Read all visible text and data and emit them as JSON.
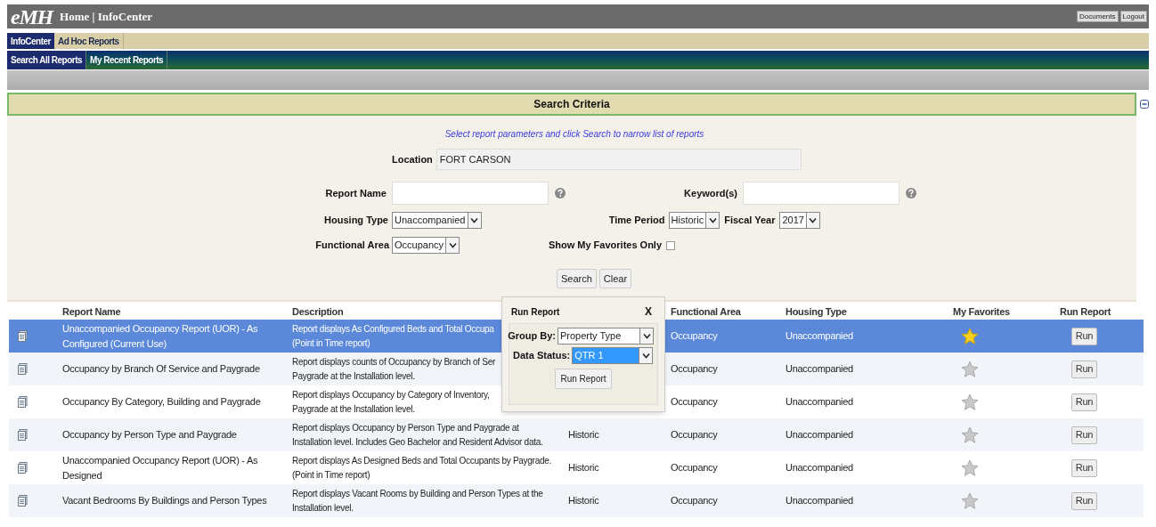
{
  "header": {
    "logo": "eMH",
    "title": "Home | InfoCenter",
    "buttons": [
      "Documents",
      "Logout"
    ]
  },
  "tabs": [
    {
      "label": "InfoCenter",
      "selected": true
    },
    {
      "label": "Ad Hoc Reports",
      "selected": false
    }
  ],
  "subtabs": [
    {
      "label": "Search All Reports",
      "selected": true
    },
    {
      "label": "My Recent Reports",
      "selected": false
    }
  ],
  "search_criteria": {
    "title": "Search Criteria",
    "expanded": true,
    "instructions": "Select report parameters and click Search to narrow list of reports",
    "location": {
      "label": "Location",
      "value": "FORT CARSON"
    },
    "report_name": {
      "label": "Report Name"
    },
    "keywords": {
      "label": "Keyword(s)"
    },
    "housing_type": {
      "label": "Housing Type",
      "value": "Unaccompanied"
    },
    "time_period": {
      "label": "Time Period",
      "value": "Historic"
    },
    "fiscal_year": {
      "label": "Fiscal Year",
      "value": "2017"
    },
    "functional_area": {
      "label": "Functional Area",
      "value": "Occupancy"
    },
    "favorites_only": {
      "label": "Show My Favorites Only",
      "checked": false
    },
    "buttons": [
      "Search",
      "Clear"
    ]
  },
  "table": {
    "columns": {
      "report_name": "Report Name",
      "description": "Description",
      "functional_area": "Functional Area",
      "housing_type": "Housing Type",
      "my_favorites": "My Favorites",
      "run_report": "Run Report"
    },
    "rows": [
      {
        "selected": true,
        "name": "Unaccompanied Occupancy Report (UOR) - As Configured (Current Use)",
        "description_lines": [
          "Report displays As Configured Beds and Total Occupa",
          "(Point in Time report)"
        ],
        "functional_area": "Occupancy",
        "housing_type": "Unaccompanied",
        "favorite": true,
        "run": "Run"
      },
      {
        "selected": false,
        "name": "Occupancy by Branch Of Service and Paygrade",
        "description_lines": [
          "Report displays counts of Occupancy by Branch of Ser",
          "Paygrade at the Installation level."
        ],
        "functional_area": "Occupancy",
        "housing_type": "Unaccompanied",
        "favorite": false,
        "run": "Run"
      },
      {
        "selected": false,
        "name": "Occupancy By Category, Building and Paygrade",
        "description_lines": [
          "Report displays Occupancy by Category of Inventory,",
          "Paygrade at the Installation level."
        ],
        "functional_area": "Occupancy",
        "housing_type": "Unaccompanied",
        "favorite": false,
        "run": "Run"
      },
      {
        "selected": false,
        "name": "Occupancy by Person Type and Paygrade",
        "description_lines": [
          "Report displays Occupancy by Person Type and Paygrade at",
          "Installation level. Includes Geo Bachelor and Resident Advisor data."
        ],
        "column_3": "Historic",
        "functional_area": "Occupancy",
        "housing_type": "Unaccompanied",
        "favorite": false,
        "run": "Run"
      },
      {
        "selected": false,
        "name": "Unaccompanied Occupancy Report (UOR) - As Designed",
        "description_lines": [
          "Report displays As Designed Beds and Total Occupants by Paygrade.",
          "(Point in Time report)"
        ],
        "column_3": "Historic",
        "functional_area": "Occupancy",
        "housing_type": "Unaccompanied",
        "favorite": false,
        "run": "Run"
      },
      {
        "selected": false,
        "name": "Vacant Bedrooms By Buildings and Person Types",
        "description_lines": [
          "Report displays Vacant Rooms by Building and Person Types at the",
          "Installation level."
        ],
        "column_3": "Historic",
        "functional_area": "Occupancy",
        "housing_type": "Unaccompanied",
        "favorite": false,
        "run": "Run"
      }
    ]
  },
  "popup": {
    "title": "Run Report",
    "close": "X",
    "group_by": {
      "label": "Group By:",
      "value": "Property Type",
      "focused": false
    },
    "data_status": {
      "label": "Data Status:",
      "value": "QTR 1",
      "focused": true
    },
    "button": "Run Report"
  }
}
